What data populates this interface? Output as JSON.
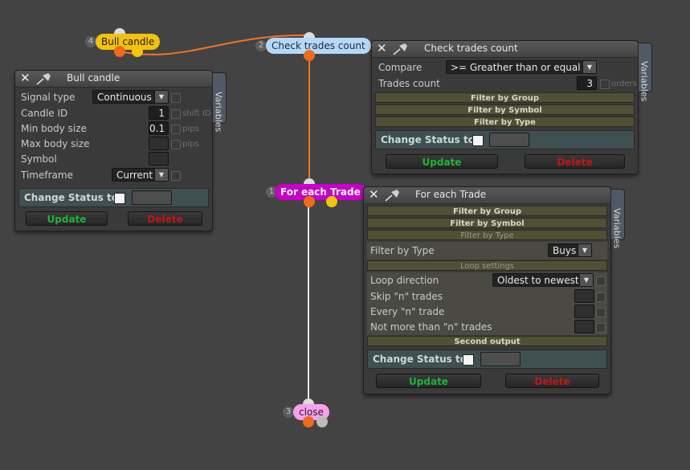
{
  "colors": {
    "canvas": "#434343",
    "link": "#f07428",
    "link_light": "#efe6e6",
    "node_bull": "#f4c20d",
    "node_check": "#b4d8f8",
    "node_foreach": "#c800c8",
    "node_close": "#f8a0f0",
    "update": "#1fb33a",
    "delete": "#c31616"
  },
  "nodes": {
    "bull": {
      "num": "4",
      "label": "Bull candle"
    },
    "check": {
      "num": "2",
      "label": "Check trades count"
    },
    "foreach": {
      "num": "1",
      "label": "For each Trade"
    },
    "close": {
      "num": "3",
      "label": "close"
    }
  },
  "bull_panel": {
    "title": "Bull candle",
    "variables_tab": "Variables",
    "signal_type_label": "Signal type",
    "signal_type_value": "Continuous",
    "candle_id_label": "Candle ID",
    "candle_id_value": "1",
    "shift_id_label": "shift ID",
    "min_body_label": "Min body size",
    "min_body_value": "0.1",
    "max_body_label": "Max body size",
    "pips1": "pips",
    "pips2": "pips",
    "symbol_label": "Symbol",
    "timeframe_label": "Timeframe",
    "timeframe_value": "Current",
    "change_status_label": "Change Status to",
    "update_label": "Update",
    "delete_label": "Delete"
  },
  "check_panel": {
    "title": "Check trades count",
    "variables_tab": "Variables",
    "compare_label": "Compare",
    "compare_value": ">= Greather than or equal to",
    "trades_count_label": "Trades count",
    "trades_count_value": "3",
    "orders_label": "orders",
    "filter_group": "Filter by Group",
    "filter_symbol": "Filter by Symbol",
    "filter_type": "Filter by Type",
    "change_status_label": "Change Status to",
    "update_label": "Update",
    "delete_label": "Delete"
  },
  "foreach_panel": {
    "title": "For each Trade",
    "variables_tab": "Variables",
    "filter_group": "Filter by Group",
    "filter_symbol": "Filter by Symbol",
    "filter_type_header": "Filter by Type",
    "filter_type_label": "Filter by Type",
    "filter_type_value": "Buys",
    "loop_settings": "Loop settings",
    "loop_direction_label": "Loop direction",
    "loop_direction_value": "Oldest to newest",
    "skip_label": "Skip \"n\" trades",
    "every_label": "Every \"n\" trade",
    "not_more_label": "Not more than \"n\" trades",
    "second_output": "Second output",
    "change_status_label": "Change Status to",
    "update_label": "Update",
    "delete_label": "Delete"
  }
}
